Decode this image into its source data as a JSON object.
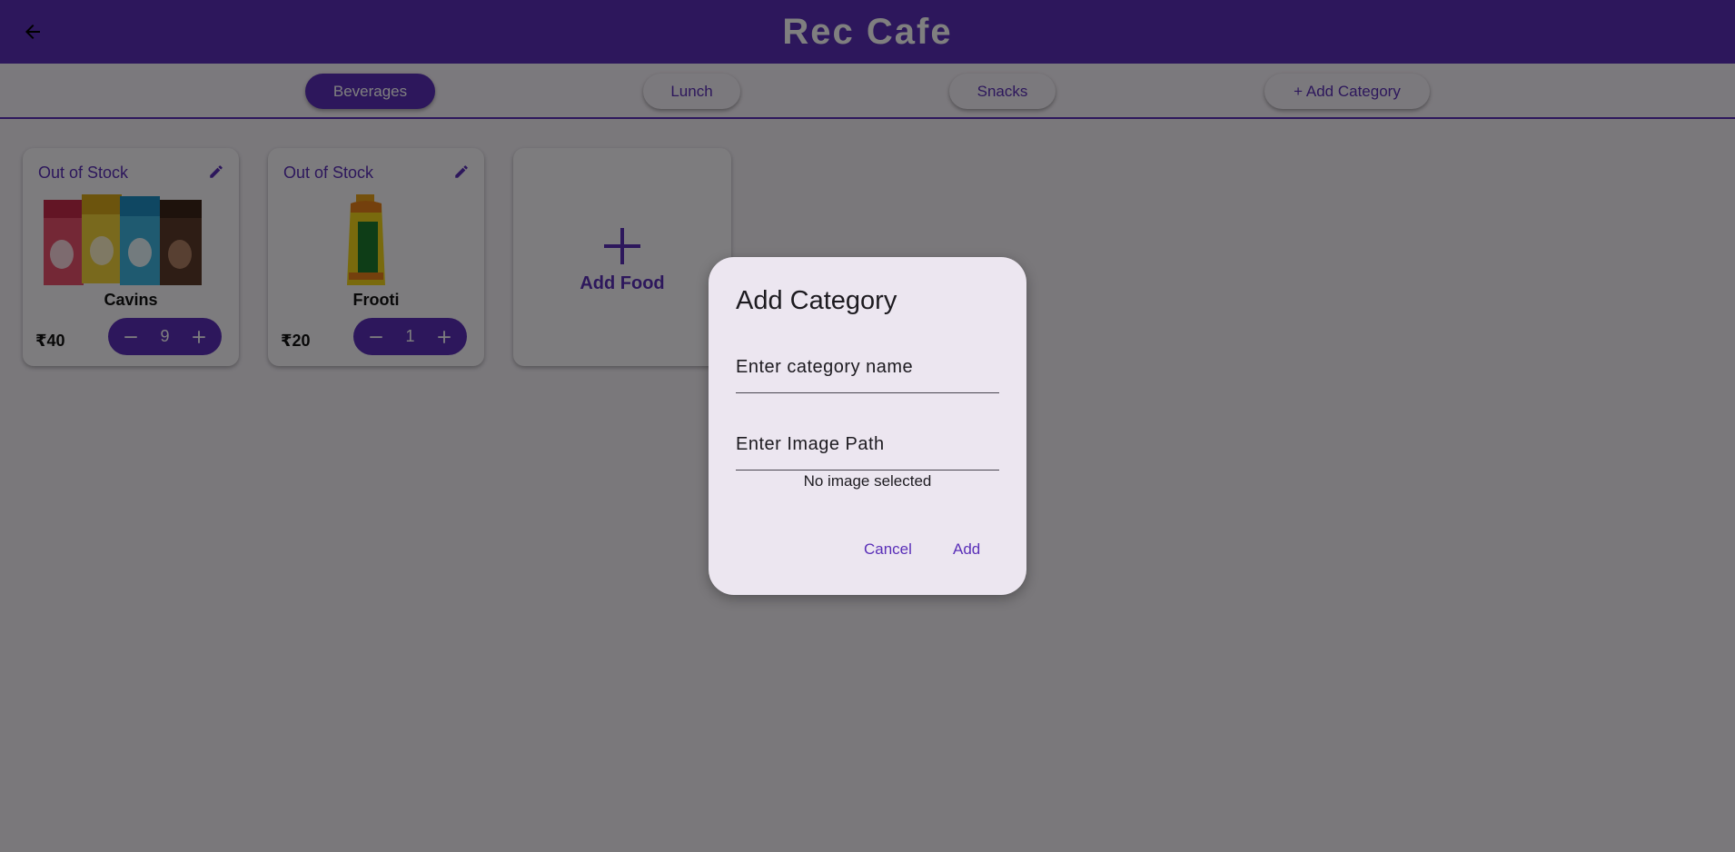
{
  "appbar": {
    "title": "Rec Cafe",
    "back_icon": "arrow-left-icon"
  },
  "tabs": [
    {
      "label": "Beverages",
      "active": true
    },
    {
      "label": "Lunch",
      "active": false
    },
    {
      "label": "Snacks",
      "active": false
    },
    {
      "label": "+ Add Category",
      "active": false
    }
  ],
  "foods": [
    {
      "status": "Out of Stock",
      "name": "Cavins",
      "price": "₹40",
      "quantity": "9"
    },
    {
      "status": "Out of Stock",
      "name": "Frooti",
      "price": "₹20",
      "quantity": "1"
    }
  ],
  "add_food": {
    "label": "Add Food"
  },
  "dialog": {
    "title": "Add Category",
    "name_placeholder": "Enter category name",
    "path_placeholder": "Enter Image Path",
    "no_image": "No image selected",
    "cancel_label": "Cancel",
    "add_label": "Add"
  },
  "colors": {
    "primary": "#5a2fb8",
    "surface": "#fbf8fd",
    "dialog": "#ece6f0"
  }
}
